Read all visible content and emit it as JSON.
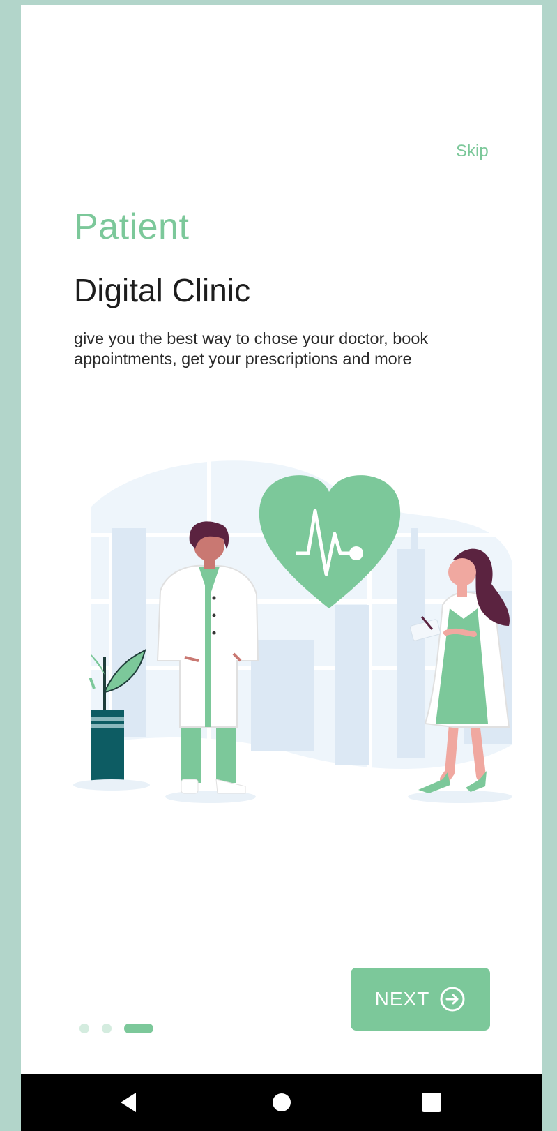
{
  "onboarding": {
    "skip_label": "Skip",
    "title": "Patient",
    "subtitle": "Digital Clinic",
    "description": "give you the best way to chose your doctor, book appointments, get your prescriptions and more",
    "next_label": "NEXT",
    "page_indicator": {
      "total": 3,
      "active_index": 2
    }
  },
  "illustration": {
    "name": "doctors-with-heart-illustration",
    "icons": [
      "heart-pulse-icon",
      "male-doctor",
      "female-doctor",
      "potted-plant"
    ]
  },
  "navigation_bar": {
    "buttons": [
      "back-icon",
      "home-icon",
      "recents-icon"
    ]
  },
  "colors": {
    "accent": "#7cc89a",
    "frame": "#b2d5ca",
    "indicator_inactive": "#d4ecdf",
    "text_dark": "#1d1d1d",
    "nav_bar": "#000000"
  }
}
